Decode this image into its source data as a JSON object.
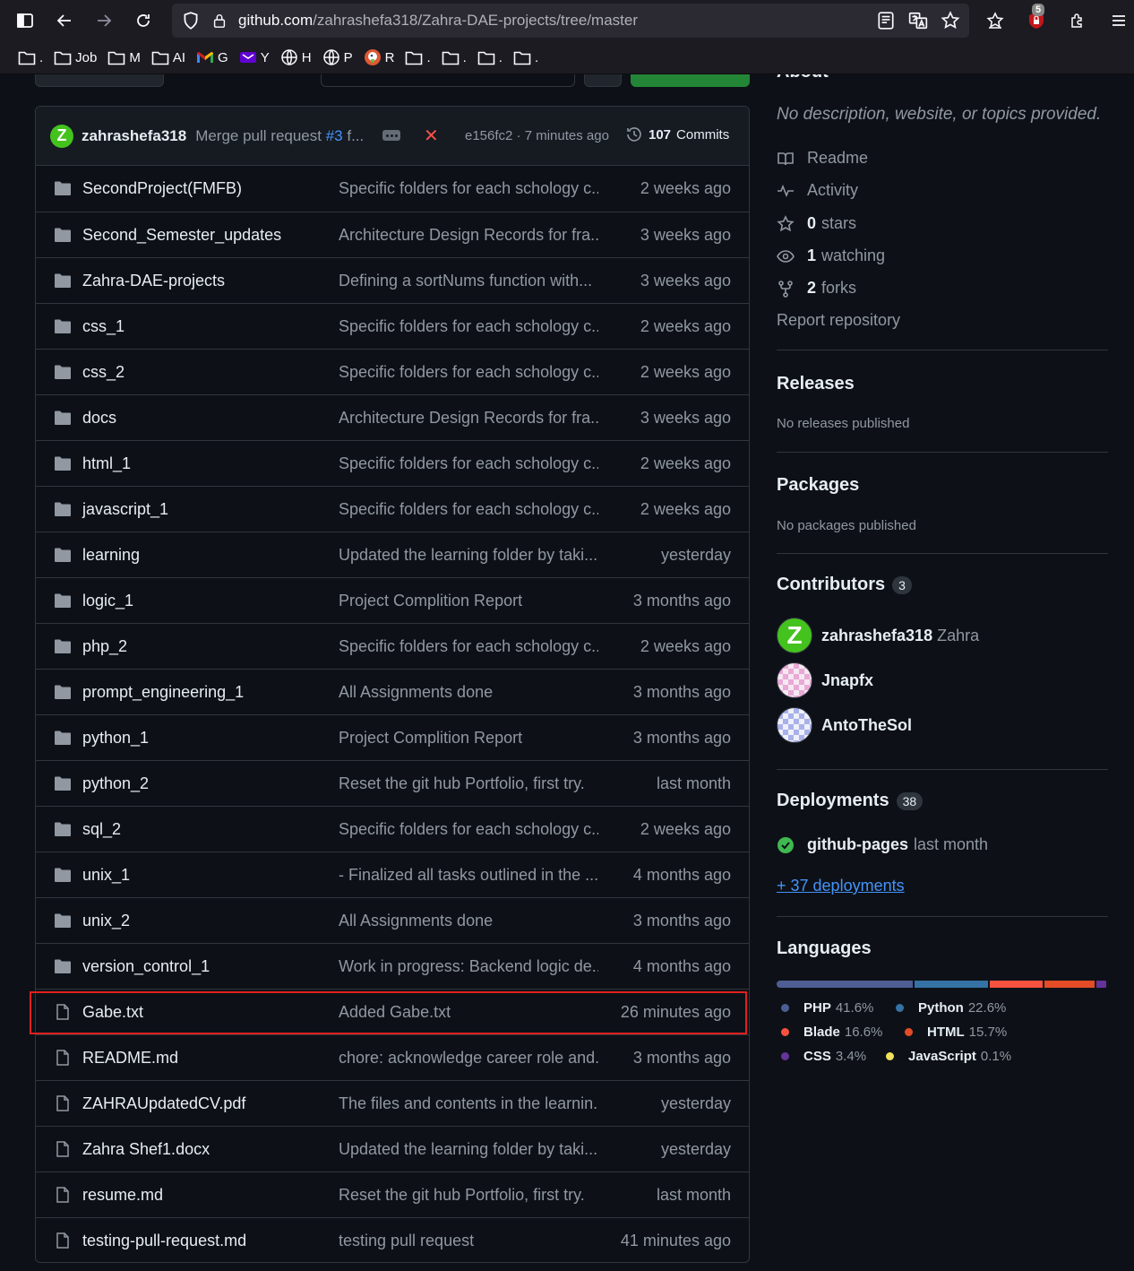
{
  "browser": {
    "url_host": "github.com",
    "url_path": "/zahrashefa318/Zahra-DAE-projects/tree/master",
    "extension_badge": "5",
    "bookmarks": [
      {
        "label": ".",
        "icon": "folder-icon"
      },
      {
        "label": "Job",
        "icon": "folder-icon"
      },
      {
        "label": "M",
        "icon": "folder-icon"
      },
      {
        "label": "AI",
        "icon": "folder-icon"
      },
      {
        "label": "G",
        "icon": "gmail-icon"
      },
      {
        "label": "Y",
        "icon": "yahoo-icon"
      },
      {
        "label": "H",
        "icon": "globe-icon"
      },
      {
        "label": "P",
        "icon": "globe-icon"
      },
      {
        "label": "R",
        "icon": "duckduckgo-icon"
      },
      {
        "label": ".",
        "icon": "folder-icon"
      },
      {
        "label": ".",
        "icon": "folder-icon"
      },
      {
        "label": ".",
        "icon": "folder-icon"
      },
      {
        "label": ".",
        "icon": "folder-icon"
      }
    ]
  },
  "commit": {
    "avatar_letter": "Z",
    "user": "zahrashefa318",
    "message_prefix": "Merge pull request ",
    "message_link": "#3",
    "message_suffix": " f...",
    "sha_time": "e156fc2 · 7 minutes ago",
    "commits_count": "107",
    "commits_label": "Commits"
  },
  "files": [
    {
      "type": "dir",
      "name": "SecondProject(FMFB)",
      "message": "Specific folders for each schology c...",
      "date": "2 weeks ago"
    },
    {
      "type": "dir",
      "name": "Second_Semester_updates",
      "message": "Architecture Design Records for fra...",
      "date": "3 weeks ago"
    },
    {
      "type": "dir",
      "name": "Zahra-DAE-projects",
      "message": "Defining a sortNums function with...",
      "date": "3 weeks ago"
    },
    {
      "type": "dir",
      "name": "css_1",
      "message": "Specific folders for each schology c...",
      "date": "2 weeks ago"
    },
    {
      "type": "dir",
      "name": "css_2",
      "message": "Specific folders for each schology c...",
      "date": "2 weeks ago"
    },
    {
      "type": "dir",
      "name": "docs",
      "message": "Architecture Design Records for fra...",
      "date": "3 weeks ago"
    },
    {
      "type": "dir",
      "name": "html_1",
      "message": "Specific folders for each schology c...",
      "date": "2 weeks ago"
    },
    {
      "type": "dir",
      "name": "javascript_1",
      "message": "Specific folders for each schology c...",
      "date": "2 weeks ago"
    },
    {
      "type": "dir",
      "name": "learning",
      "message": "Updated the learning folder by taki...",
      "date": "yesterday"
    },
    {
      "type": "dir",
      "name": "logic_1",
      "message": "Project Complition Report",
      "date": "3 months ago"
    },
    {
      "type": "dir",
      "name": "php_2",
      "message": "Specific folders for each schology c...",
      "date": "2 weeks ago"
    },
    {
      "type": "dir",
      "name": "prompt_engineering_1",
      "message": "All Assignments done",
      "date": "3 months ago"
    },
    {
      "type": "dir",
      "name": "python_1",
      "message": "Project Complition Report",
      "date": "3 months ago"
    },
    {
      "type": "dir",
      "name": "python_2",
      "message": "Reset the git hub Portfolio, first try.",
      "date": "last month"
    },
    {
      "type": "dir",
      "name": "sql_2",
      "message": "Specific folders for each schology c...",
      "date": "2 weeks ago"
    },
    {
      "type": "dir",
      "name": "unix_1",
      "message": "- Finalized all tasks outlined in the ...",
      "date": "4 months ago"
    },
    {
      "type": "dir",
      "name": "unix_2",
      "message": "All Assignments done",
      "date": "3 months ago"
    },
    {
      "type": "dir",
      "name": "version_control_1",
      "message": "Work in progress: Backend logic de...",
      "date": "4 months ago"
    },
    {
      "type": "file",
      "name": "Gabe.txt",
      "message": "Added Gabe.txt",
      "date": "26 minutes ago"
    },
    {
      "type": "file",
      "name": "README.md",
      "message": "chore: acknowledge career role and...",
      "date": "3 months ago"
    },
    {
      "type": "file",
      "name": "ZAHRAUpdatedCV.pdf",
      "message": "The files and contents in the learnin...",
      "date": "yesterday"
    },
    {
      "type": "file",
      "name": "Zahra Shef1.docx",
      "message": "Updated the learning folder by taki...",
      "date": "yesterday"
    },
    {
      "type": "file",
      "name": "resume.md",
      "message": "Reset the git hub Portfolio, first try.",
      "date": "last month"
    },
    {
      "type": "file",
      "name": "testing-pull-request.md",
      "message": "testing pull request",
      "date": "41 minutes ago"
    }
  ],
  "about": {
    "description": "No description, website, or topics provided.",
    "readme": "Readme",
    "activity": "Activity",
    "stars_count": "0",
    "stars_label": "stars",
    "watching_count": "1",
    "watching_label": "watching",
    "forks_count": "2",
    "forks_label": "forks",
    "report": "Report repository"
  },
  "releases": {
    "title": "Releases",
    "subtitle": "No releases published"
  },
  "packages": {
    "title": "Packages",
    "subtitle": "No packages published"
  },
  "contributors": {
    "title": "Contributors",
    "count": "3",
    "list": [
      {
        "login": "zahrashefa318",
        "name": "Zahra"
      },
      {
        "login": "Jnapfx",
        "name": ""
      },
      {
        "login": "AntoTheSol",
        "name": ""
      }
    ]
  },
  "deployments": {
    "title": "Deployments",
    "count": "38",
    "env": "github-pages",
    "time": "last month",
    "more": "+ 37 deployments"
  },
  "languages": {
    "title": "Languages",
    "items": [
      {
        "name": "PHP",
        "percent": "41.6%",
        "value": 41.6,
        "color": "#4F5D95"
      },
      {
        "name": "Python",
        "percent": "22.6%",
        "value": 22.6,
        "color": "#3572A5"
      },
      {
        "name": "Blade",
        "percent": "16.6%",
        "value": 16.6,
        "color": "#f7523f"
      },
      {
        "name": "HTML",
        "percent": "15.7%",
        "value": 15.7,
        "color": "#e34c26"
      },
      {
        "name": "CSS",
        "percent": "3.4%",
        "value": 3.4,
        "color": "#663399"
      },
      {
        "name": "JavaScript",
        "percent": "0.1%",
        "value": 0.1,
        "color": "#f1e05a"
      }
    ]
  }
}
